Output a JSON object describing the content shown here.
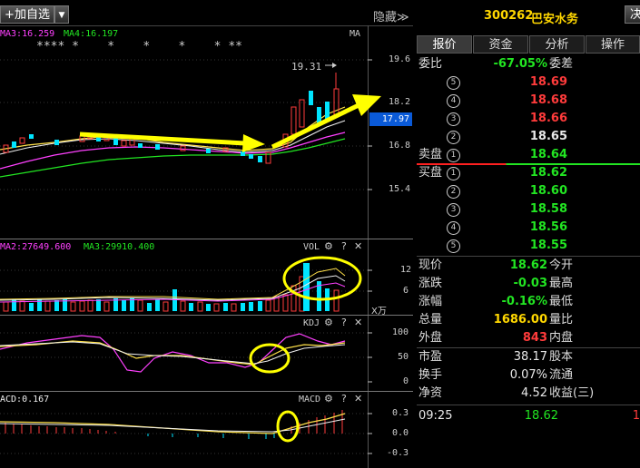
{
  "toolbar": {
    "add_watchlist": "+加自选",
    "dropdown": "▼",
    "hide_label": "隐藏",
    "hide_arrows": "≫",
    "decision": "决"
  },
  "stock": {
    "code": "300262",
    "name": "巴安水务"
  },
  "tabs": [
    "报价",
    "资金",
    "分析",
    "操作"
  ],
  "main_chart": {
    "ma3_label": "MA3:16.259",
    "ma4_label": "MA4:16.197",
    "ma_btn": "MA",
    "stars": "**** *    *    *    *    * **",
    "high_label": "19.31",
    "price_ticks": [
      "19.6",
      "18.2",
      "16.8",
      "15.4"
    ],
    "current_price": "17.97"
  },
  "vol_chart": {
    "ma2_label": "MA2:27649.600",
    "ma3_label": "MA3:29910.400",
    "name": "VOL",
    "ticks": [
      "12",
      "6"
    ],
    "unit": "X万"
  },
  "kdj_chart": {
    "name": "KDJ",
    "ticks": [
      "100",
      "50",
      "0"
    ]
  },
  "macd_chart": {
    "label": "ACD:0.167",
    "name": "MACD",
    "ticks": [
      "0.3",
      "0.0",
      "-0.3"
    ]
  },
  "icons": {
    "gear": "⚙",
    "help": "?",
    "close": "✕"
  },
  "quote": {
    "commission_ratio_label": "委比",
    "commission_ratio": "-67.05%",
    "commission_diff_label": "委差",
    "sell_label": "卖盘",
    "buy_label": "买盘",
    "asks": [
      {
        "level": "5",
        "price": "18.69"
      },
      {
        "level": "4",
        "price": "18.68"
      },
      {
        "level": "3",
        "price": "18.66"
      },
      {
        "level": "2",
        "price": "18.65"
      },
      {
        "level": "1",
        "price": "18.64"
      }
    ],
    "bids": [
      {
        "level": "1",
        "price": "18.62"
      },
      {
        "level": "2",
        "price": "18.60"
      },
      {
        "level": "3",
        "price": "18.58"
      },
      {
        "level": "4",
        "price": "18.56"
      },
      {
        "level": "5",
        "price": "18.55"
      }
    ],
    "stats": [
      {
        "l1": "现价",
        "v1": "18.62",
        "l2": "今开"
      },
      {
        "l1": "涨跌",
        "v1": "-0.03",
        "l2": "最高"
      },
      {
        "l1": "涨幅",
        "v1": "-0.16%",
        "l2": "最低"
      },
      {
        "l1": "总量",
        "v1": "1686.00",
        "l2": "量比"
      },
      {
        "l1": "外盘",
        "v1": "843",
        "l2": "内盘"
      },
      {
        "l1": "市盈",
        "v1": "38.17",
        "l2": "股本"
      },
      {
        "l1": "换手",
        "v1": "0.07%",
        "l2": "流通"
      },
      {
        "l1": "净资",
        "v1": "4.52",
        "l2": "收益(三)"
      }
    ],
    "tick_time": "09:25",
    "tick_price": "18.62",
    "tick_cut": "1"
  },
  "colors": {
    "up": "#ff3b3b",
    "down": "#22e522",
    "accent": "#ffd700",
    "highlight": "#0a5ad8"
  }
}
